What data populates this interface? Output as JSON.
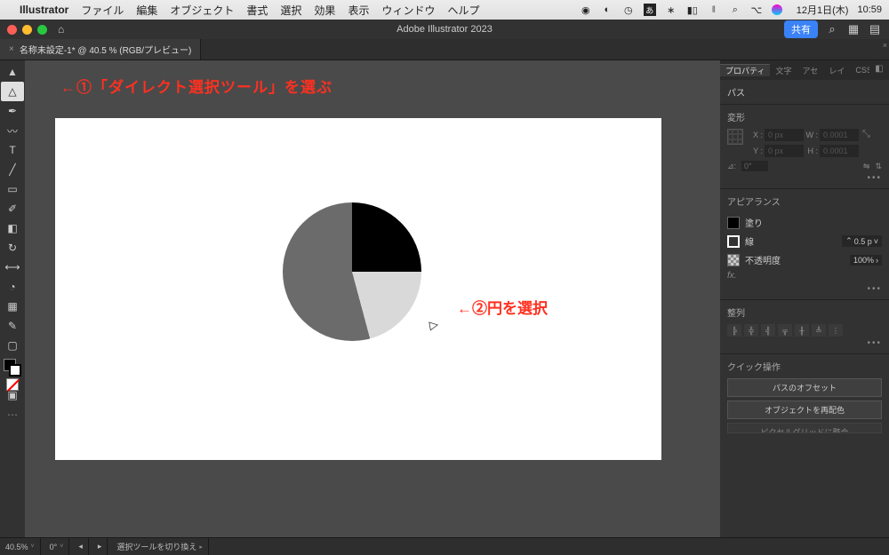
{
  "menubar": {
    "app_name": "Illustrator",
    "items": [
      "ファイル",
      "編集",
      "オブジェクト",
      "書式",
      "選択",
      "効果",
      "表示",
      "ウィンドウ",
      "ヘルプ"
    ],
    "date": "12月1日(木)",
    "time": "10:59"
  },
  "window": {
    "title": "Adobe Illustrator 2023",
    "share": "共有"
  },
  "doc_tab": {
    "label": "名称未設定-1* @ 40.5 % (RGB/プレビュー)"
  },
  "annotations": {
    "step1": "←①「ダイレクト選択ツール」を選ぶ",
    "step2": "←②円を選択"
  },
  "panel_tabs": [
    "プロパティ",
    "文字",
    "アセ",
    "レイ",
    "CSS"
  ],
  "properties": {
    "subtype": "パス",
    "transform_title": "変形",
    "x_label": "X :",
    "x_val": "0 px",
    "y_label": "Y :",
    "y_val": "0 px",
    "w_label": "W :",
    "w_val": "0.0001",
    "h_label": "H :",
    "h_val": "0.0001",
    "angle_label": "⊿:",
    "angle_val": "0°",
    "flip": "⟵⟶",
    "appearance_title": "アピアランス",
    "fill": "塗り",
    "stroke": "線",
    "stroke_val": "0.5 p",
    "opacity": "不透明度",
    "opacity_val": "100%",
    "fx": "fx.",
    "align_title": "整列",
    "quick_title": "クイック操作",
    "qa1": "パスのオフセット",
    "qa2": "オブジェクトを再配色",
    "qa3": "ピクセルグリッドに整合"
  },
  "status": {
    "zoom": "40.5%",
    "rotate": "0°",
    "hint": "選択ツールを切り換え"
  },
  "chart_data": {
    "type": "pie",
    "title": "",
    "series": [
      {
        "name": "black-slice",
        "value": 25,
        "color": "#000000"
      },
      {
        "name": "light-gray-slice",
        "value": 21,
        "color": "#d9d9d9"
      },
      {
        "name": "dark-gray-slice",
        "value": 54,
        "color": "#6b6b6b"
      }
    ]
  }
}
